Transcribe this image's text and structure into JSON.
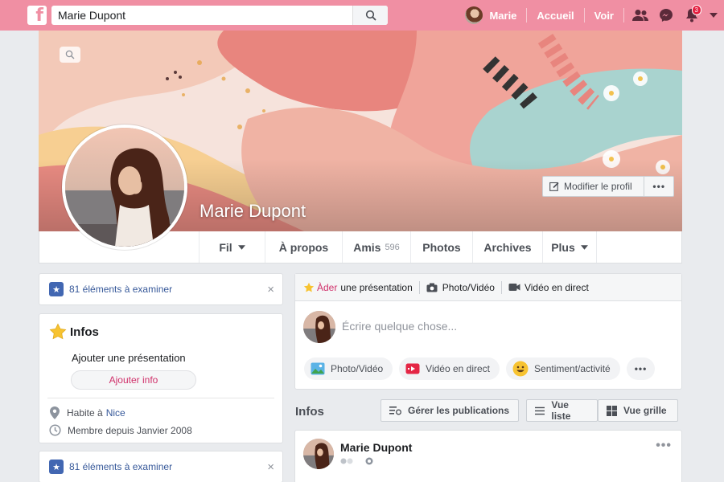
{
  "search": {
    "value": "Marie Dupont"
  },
  "nav": {
    "user_name": "Marie",
    "home": "Accueil",
    "watch": "Voir",
    "notif_count": "3"
  },
  "profile": {
    "name": "Marie Dupont",
    "edit_label": "Modifier le profil",
    "more_label": "•••"
  },
  "tabs": [
    {
      "label": "Fil"
    },
    {
      "label": "À propos"
    },
    {
      "label": "Amis",
      "count": "596"
    },
    {
      "label": "Photos"
    },
    {
      "label": "Archives"
    },
    {
      "label": "Plus"
    }
  ],
  "review": {
    "label": "81 éléments à examiner",
    "close": "×"
  },
  "review2": {
    "label": "81 éléments à examiner",
    "close": "×"
  },
  "infos": {
    "title": "Infos",
    "add_intro": "Ajouter une présentation",
    "add_info_button": "Ajouter info",
    "lives_prefix": "Habite à",
    "lives_city": "Nice",
    "member_since": "Membre depuis Janvier 2008"
  },
  "composer": {
    "tab_intro_highlight": "Àder",
    "tab_intro_rest": "une présentation",
    "tab_photo": "Photo/Vidéo",
    "tab_live": "Vidéo en direct",
    "placeholder": "Écrire quelque chose...",
    "action_photo": "Photo/Vidéo",
    "action_live": "Vidéo en direct",
    "action_feeling": "Sentiment/activité",
    "action_more": "•••"
  },
  "feed": {
    "title": "Infos",
    "manage": "Gérer les publications",
    "list_view": "Vue liste",
    "grid_view": "Vue grille"
  },
  "post": {
    "author": "Marie Dupont",
    "more": "•••"
  },
  "colors": {
    "topbar": "#f08fa3",
    "link": "#365899",
    "accent": "#d0306a"
  }
}
